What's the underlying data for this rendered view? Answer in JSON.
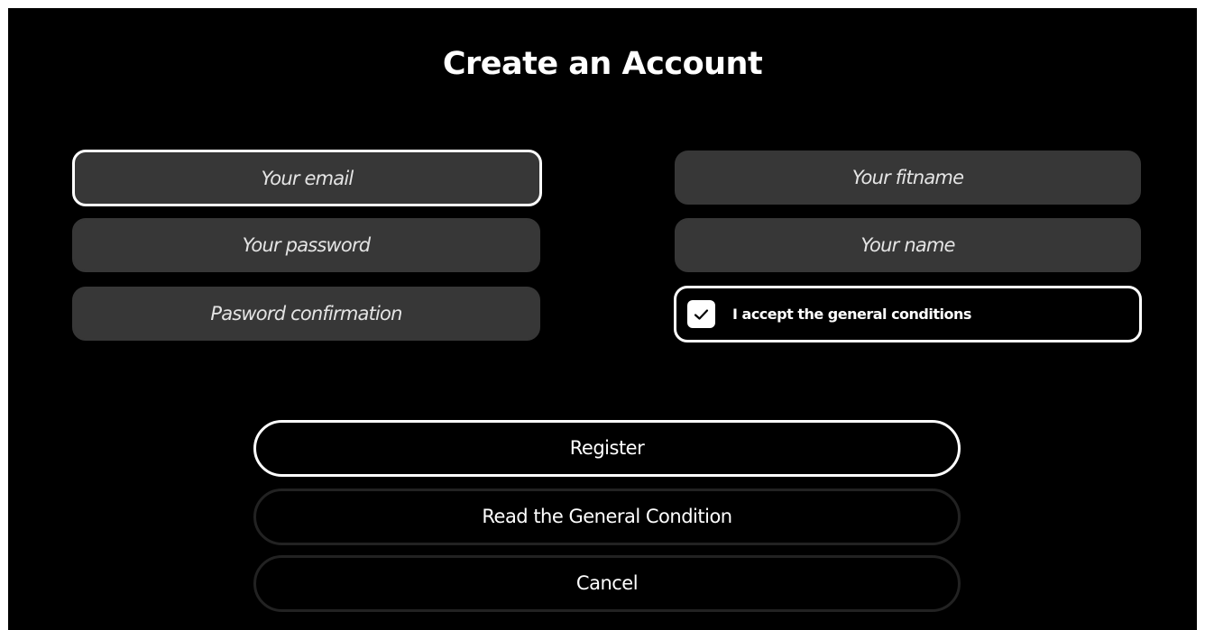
{
  "title": "Create an Account",
  "form": {
    "email_placeholder": "Your email",
    "password_placeholder": "Your password",
    "password_confirmation_placeholder": "Pasword confirmation",
    "firstname_placeholder": "Your fitname",
    "name_placeholder": "Your name",
    "accept_conditions_label": "I accept the general conditions",
    "accept_conditions_checked": true
  },
  "buttons": {
    "register_label": "Register",
    "read_conditions_label": "Read the General Condition",
    "cancel_label": "Cancel"
  },
  "icons": {
    "checkbox": "checkmark-icon"
  },
  "colors": {
    "background": "#000000",
    "field_background": "#373737",
    "text": "#ffffff",
    "placeholder_text": "#e4e4e4",
    "secondary_border": "#222222"
  }
}
